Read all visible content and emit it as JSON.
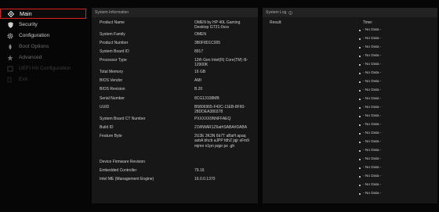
{
  "sidebar": {
    "items": [
      {
        "label": "Main",
        "icon": "sliders-icon"
      },
      {
        "label": "Security",
        "icon": "shield-icon"
      },
      {
        "label": "Configuration",
        "icon": "gear-icon"
      },
      {
        "label": "Boot Options",
        "icon": "rocket-icon"
      },
      {
        "label": "Advanced",
        "icon": "star-icon"
      },
      {
        "label": "UEFI HII Configuration",
        "icon": "sliders-icon"
      },
      {
        "label": "Exit",
        "icon": "exit-icon"
      }
    ]
  },
  "system_info": {
    "title": "System Information",
    "rows": [
      {
        "label": "Product Name",
        "value": "OMEN by HP 40L Gaming Desktop GT21-0xxx"
      },
      {
        "label": "System Family",
        "value": "OMEN"
      },
      {
        "label": "Product Number",
        "value": "3B0F8D1C005"
      },
      {
        "label": "System Board ID",
        "value": "8917"
      },
      {
        "label": "Processor Type",
        "value": "12th Gen Intel(R) Core(TM) i9-12900K"
      },
      {
        "label": "Total Memory",
        "value": "16 GB"
      },
      {
        "label": "BIOS Vendor",
        "value": "AMI"
      },
      {
        "label": "BIOS Revision",
        "value": "B.20"
      },
      {
        "label": "Serial Number",
        "value": "8CG13108MB"
      },
      {
        "label": "UUID",
        "value": "B5806965-F42C-11EB-8F60-28DDEA380378"
      },
      {
        "label": "System Board CT Number",
        "value": "PXXXXX9NNFFAEQ"
      },
      {
        "label": "Build ID",
        "value": "21WWAR1Z6at#SABA#DABA"
      },
      {
        "label": "Feature Byte",
        "value": "2U3E 3K3N 6b7T aBaH apaq asbA bhcb aJPP fdhZ jqjr sFm9 mjmn n1pn pqpr px .gh"
      },
      {
        "label": "Device Firmware Revision",
        "value": ""
      },
      {
        "label": "Embedded Controller",
        "value": "79.16"
      },
      {
        "label": "Intel ME (Management Engine)",
        "value": "16.0.0.1370"
      }
    ]
  },
  "system_log": {
    "title": "System Log",
    "result_label": "Result:",
    "time_label": "Time:",
    "entries": [
      "- No Data -",
      "- No Data -",
      "- No Data -",
      "- No Data -",
      "- No Data -",
      "- No Data -",
      "- No Data -",
      "- No Data -",
      "- No Data -",
      "- No Data -",
      "- No Data -",
      "- No Data -",
      "- No Data -",
      "- No Data -",
      "- No Data -",
      "- No Data -",
      "- No Data -",
      "- No Data -",
      "- No Data -",
      "- No Data -"
    ]
  }
}
